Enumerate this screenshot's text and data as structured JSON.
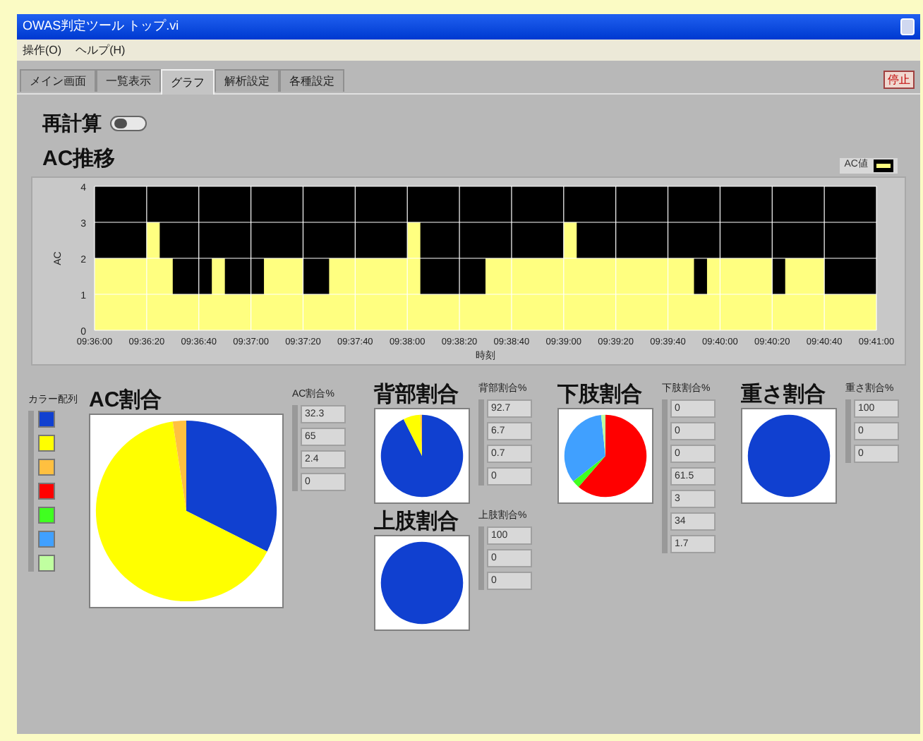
{
  "window": {
    "title": "OWAS判定ツール トップ.vi"
  },
  "menu": [
    "操作(O)",
    "ヘルプ(H)"
  ],
  "tabs": [
    {
      "label": "メイン画面",
      "selected": false
    },
    {
      "label": "一覧表示",
      "selected": false
    },
    {
      "label": "グラフ",
      "selected": true
    },
    {
      "label": "解析設定",
      "selected": false
    },
    {
      "label": "各種設定",
      "selected": false
    }
  ],
  "stop_button": "停止",
  "recalc": {
    "label": "再計算",
    "on": false
  },
  "trend": {
    "title": "AC推移",
    "chart_data": {
      "type": "area",
      "xlabel": "時刻",
      "ylabel": "AC",
      "categories": [
        "09:36:00",
        null,
        null,
        null,
        "09:36:20",
        null,
        null,
        null,
        "09:36:40",
        null,
        null,
        null,
        "09:37:00",
        null,
        null,
        null,
        "09:37:20",
        null,
        null,
        null,
        "09:37:40",
        null,
        null,
        null,
        "09:38:00",
        null,
        null,
        null,
        "09:38:20",
        null,
        null,
        null,
        "09:38:40",
        null,
        null,
        null,
        "09:39:00",
        null,
        null,
        null,
        "09:39:20",
        null,
        null,
        null,
        "09:39:40",
        null,
        null,
        null,
        "09:40:00",
        null,
        null,
        null,
        "09:40:20",
        null,
        null,
        null,
        "09:40:40",
        null,
        null,
        null,
        "09:41:00"
      ],
      "series": [
        {
          "name": "AC値",
          "color": "#ffff80",
          "values": [
            2,
            2,
            2,
            2,
            3,
            2,
            1,
            1,
            1,
            2,
            1,
            1,
            1,
            2,
            2,
            2,
            1,
            1,
            2,
            2,
            2,
            2,
            2,
            2,
            3,
            1,
            1,
            1,
            1,
            1,
            2,
            2,
            2,
            2,
            2,
            2,
            3,
            2,
            2,
            2,
            2,
            2,
            2,
            2,
            2,
            2,
            1,
            2,
            2,
            2,
            2,
            2,
            1,
            2,
            2,
            2,
            1,
            1,
            1,
            1,
            2
          ]
        }
      ],
      "ylim": [
        0,
        4
      ],
      "yticks": [
        0,
        1,
        2,
        3,
        4
      ],
      "grid": true
    }
  },
  "color_legend": {
    "label": "カラー配列",
    "items": [
      {
        "color": "#1040d0"
      },
      {
        "color": "#ffff00"
      },
      {
        "color": "#ffc040"
      },
      {
        "color": "#ff0000"
      },
      {
        "color": "#40ff20"
      },
      {
        "color": "#40a0ff"
      },
      {
        "color": "#c0ffa0"
      }
    ]
  },
  "ratios": [
    {
      "title": "AC割合",
      "values_label": "AC割合%",
      "values": [
        "32.3",
        "65",
        "2.4",
        "0"
      ],
      "chart_data": {
        "type": "pie",
        "values": [
          32.3,
          65,
          2.4,
          0
        ]
      }
    },
    {
      "title": "背部割合",
      "values_label": "背部割合%",
      "values": [
        "92.7",
        "6.7",
        "0.7",
        "0"
      ],
      "chart_data": {
        "type": "pie",
        "values": [
          92.7,
          6.7,
          0.7,
          0
        ]
      }
    },
    {
      "title": "上肢割合",
      "values_label": "上肢割合%",
      "values": [
        "100",
        "0",
        "0"
      ],
      "chart_data": {
        "type": "pie",
        "values": [
          100,
          0,
          0
        ]
      }
    },
    {
      "title": "下肢割合",
      "values_label": "下肢割合%",
      "values": [
        "0",
        "0",
        "0",
        "61.5",
        "3",
        "34",
        "1.7"
      ],
      "chart_data": {
        "type": "pie",
        "values": [
          0,
          0,
          0,
          61.5,
          3,
          34,
          1.7
        ]
      }
    },
    {
      "title": "重さ割合",
      "values_label": "重さ割合%",
      "values": [
        "100",
        "0",
        "0"
      ],
      "chart_data": {
        "type": "pie",
        "values": [
          100,
          0,
          0
        ]
      }
    }
  ]
}
